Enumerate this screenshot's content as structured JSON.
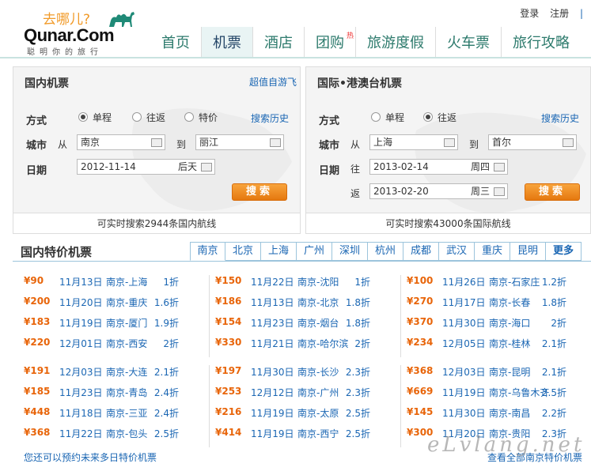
{
  "header": {
    "logo_tag": "去哪儿?",
    "logo_brand": "Qunar.Com",
    "logo_slogan": "聪明你的旅行",
    "login": "登录",
    "register": "注册",
    "nav": [
      "首页",
      "机票",
      "酒店",
      "团购",
      "旅游度假",
      "火车票",
      "旅行攻略"
    ],
    "nav_hot": "热"
  },
  "domestic": {
    "title": "国内机票",
    "link": "超值自游飞",
    "mode_label": "方式",
    "modes": [
      "单程",
      "往返",
      "特价"
    ],
    "history": "搜索历史",
    "city_label": "城市",
    "from_label": "从",
    "from": "南京",
    "to_label": "到",
    "to": "丽江",
    "date_label": "日期",
    "date": "2012-11-14",
    "date_week": "后天",
    "search": "搜索",
    "footer": "可实时搜索2944条国内航线"
  },
  "intl": {
    "title": "国际•港澳台机票",
    "mode_label": "方式",
    "modes": [
      "单程",
      "往返"
    ],
    "history": "搜索历史",
    "city_label": "城市",
    "from_label": "从",
    "from": "上海",
    "to_label": "到",
    "to": "首尔",
    "date_label": "日期",
    "go_label": "往",
    "go_date": "2013-02-14",
    "go_week": "周四",
    "back_label": "返",
    "back_date": "2013-02-20",
    "back_week": "周三",
    "search": "搜索",
    "footer": "可实时搜索43000条国际航线"
  },
  "special": {
    "title": "国内特价机票",
    "cities": [
      "南京",
      "北京",
      "上海",
      "广州",
      "深圳",
      "杭州",
      "成都",
      "武汉",
      "重庆",
      "昆明",
      "更多"
    ],
    "columns": [
      [
        {
          "price": "¥90",
          "date": "11月13日",
          "route": "南京-上海",
          "discount": "1折"
        },
        {
          "price": "¥200",
          "date": "11月20日",
          "route": "南京-重庆",
          "discount": "1.6折"
        },
        {
          "price": "¥183",
          "date": "11月19日",
          "route": "南京-厦门",
          "discount": "1.9折"
        },
        {
          "price": "¥220",
          "date": "12月01日",
          "route": "南京-西安",
          "discount": "2折"
        },
        {
          "price": "¥191",
          "date": "12月03日",
          "route": "南京-大连",
          "discount": "2.1折"
        },
        {
          "price": "¥185",
          "date": "11月23日",
          "route": "南京-青岛",
          "discount": "2.4折"
        },
        {
          "price": "¥448",
          "date": "11月18日",
          "route": "南京-三亚",
          "discount": "2.4折"
        },
        {
          "price": "¥368",
          "date": "11月22日",
          "route": "南京-包头",
          "discount": "2.5折"
        }
      ],
      [
        {
          "price": "¥150",
          "date": "11月22日",
          "route": "南京-沈阳",
          "discount": "1折"
        },
        {
          "price": "¥186",
          "date": "11月13日",
          "route": "南京-北京",
          "discount": "1.8折"
        },
        {
          "price": "¥154",
          "date": "11月23日",
          "route": "南京-烟台",
          "discount": "1.8折"
        },
        {
          "price": "¥330",
          "date": "11月21日",
          "route": "南京-哈尔滨",
          "discount": "2折"
        },
        {
          "price": "¥197",
          "date": "11月30日",
          "route": "南京-长沙",
          "discount": "2.3折"
        },
        {
          "price": "¥253",
          "date": "12月12日",
          "route": "南京-广州",
          "discount": "2.3折"
        },
        {
          "price": "¥216",
          "date": "11月19日",
          "route": "南京-太原",
          "discount": "2.5折"
        },
        {
          "price": "¥414",
          "date": "11月19日",
          "route": "南京-西宁",
          "discount": "2.5折"
        }
      ],
      [
        {
          "price": "¥100",
          "date": "11月26日",
          "route": "南京-石家庄",
          "discount": "1.2折"
        },
        {
          "price": "¥270",
          "date": "11月17日",
          "route": "南京-长春",
          "discount": "1.8折"
        },
        {
          "price": "¥370",
          "date": "11月30日",
          "route": "南京-海口",
          "discount": "2折"
        },
        {
          "price": "¥234",
          "date": "12月05日",
          "route": "南京-桂林",
          "discount": "2.1折"
        },
        {
          "price": "¥368",
          "date": "12月03日",
          "route": "南京-昆明",
          "discount": "2.1折"
        },
        {
          "price": "¥669",
          "date": "11月19日",
          "route": "南京-乌鲁木齐",
          "discount": "2.5折"
        },
        {
          "price": "¥145",
          "date": "11月30日",
          "route": "南京-南昌",
          "discount": "2.2折"
        },
        {
          "price": "¥300",
          "date": "11月20日",
          "route": "南京-贵阳",
          "discount": "2.3折"
        }
      ]
    ],
    "more_left": "您还可以预约未来多日特价机票",
    "more_right": "查看全部南京特价机票"
  },
  "watermark": "eLvlang.net"
}
